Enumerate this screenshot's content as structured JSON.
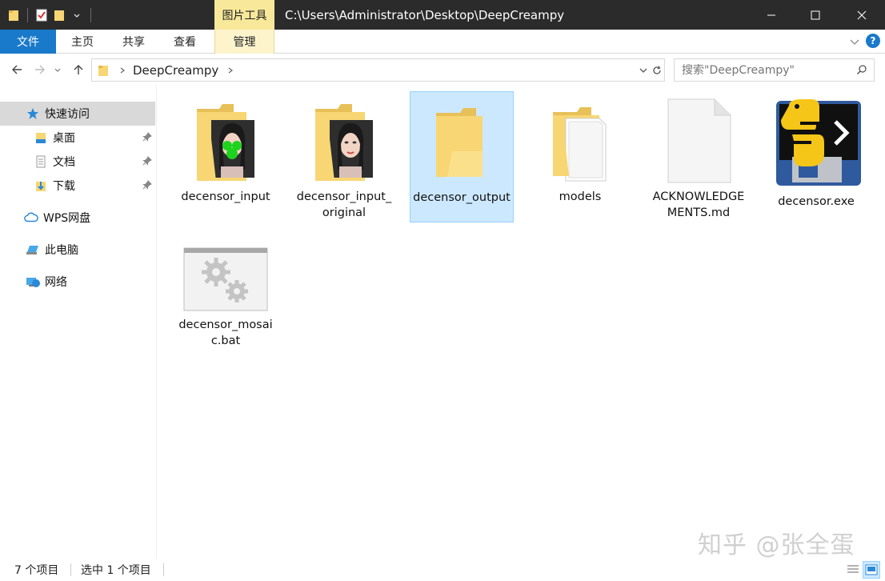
{
  "titlebar": {
    "tool_tab": "图片工具",
    "path": "C:\\Users\\Administrator\\Desktop\\DeepCreampy"
  },
  "ribbon": {
    "tabs": [
      "文件",
      "主页",
      "共享",
      "查看",
      "管理"
    ],
    "help": "?"
  },
  "address": {
    "crumb": "DeepCreampy",
    "search_placeholder": "搜索\"DeepCreampy\""
  },
  "sidebar": {
    "items": [
      {
        "label": "快速访问",
        "icon": "star-icon"
      },
      {
        "label": "桌面",
        "icon": "desktop-folder-icon",
        "pinned": true
      },
      {
        "label": "文档",
        "icon": "documents-icon",
        "pinned": true
      },
      {
        "label": "下载",
        "icon": "downloads-icon",
        "pinned": true
      },
      {
        "label": "WPS网盘",
        "icon": "cloud-icon"
      },
      {
        "label": "此电脑",
        "icon": "computer-icon"
      },
      {
        "label": "网络",
        "icon": "network-icon"
      }
    ]
  },
  "files": [
    {
      "name": "decensor_input",
      "type": "image-folder"
    },
    {
      "name": "decensor_input_original",
      "type": "image-folder"
    },
    {
      "name": "decensor_output",
      "type": "folder",
      "selected": true
    },
    {
      "name": "models",
      "type": "document-folder"
    },
    {
      "name": "ACKNOWLEDGEMENTS.md",
      "type": "file"
    },
    {
      "name": "decensor.exe",
      "type": "python-exe"
    },
    {
      "name": "decensor_mosaic.bat",
      "type": "batch-file"
    }
  ],
  "status": {
    "count": "7 个项目",
    "selected": "选中 1 个项目"
  },
  "watermark": "知乎 @张全蛋",
  "colors": {
    "accent": "#1979ca",
    "selection": "#cce8ff",
    "folder": "#f7d673",
    "titlebar": "#2b2b2b",
    "tool_tab": "#f8e89a"
  }
}
